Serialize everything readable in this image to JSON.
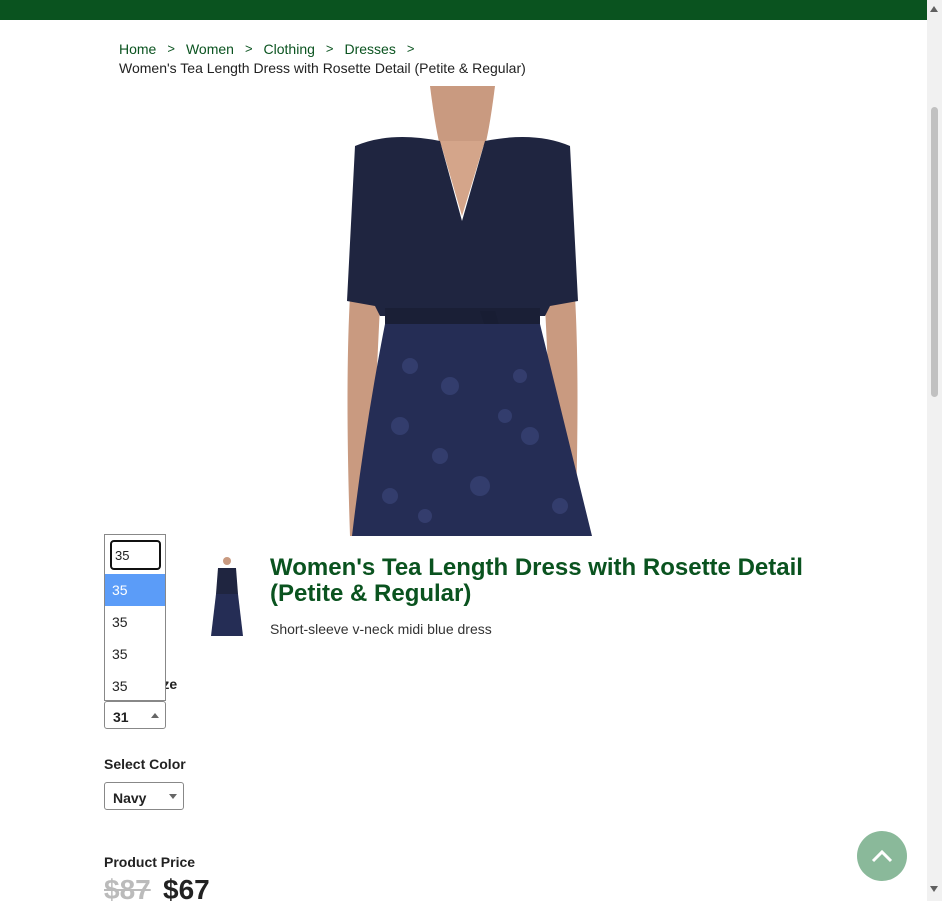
{
  "breadcrumb": {
    "items": [
      "Home",
      "Women",
      "Clothing",
      "Dresses"
    ],
    "separator": ">",
    "current": "Women's Tea Length Dress with Rosette Detail (Petite & Regular)"
  },
  "product": {
    "title": "Women's Tea Length Dress with Rosette Detail (Petite & Regular)",
    "description": "Short-sleeve v-neck midi blue dress",
    "dress_color": "#1f2540"
  },
  "size": {
    "label": "Select Size",
    "selected": "31",
    "search_value": "35",
    "options": [
      "35",
      "35",
      "35",
      "35"
    ]
  },
  "color": {
    "label": "Select Color",
    "selected": "Navy"
  },
  "price": {
    "label": "Product Price",
    "original": "$87",
    "sale": "$67"
  },
  "colors": {
    "brand": "#0a531f",
    "option_highlight": "#5b9cf8",
    "scroll_button": "#8ab99a"
  }
}
